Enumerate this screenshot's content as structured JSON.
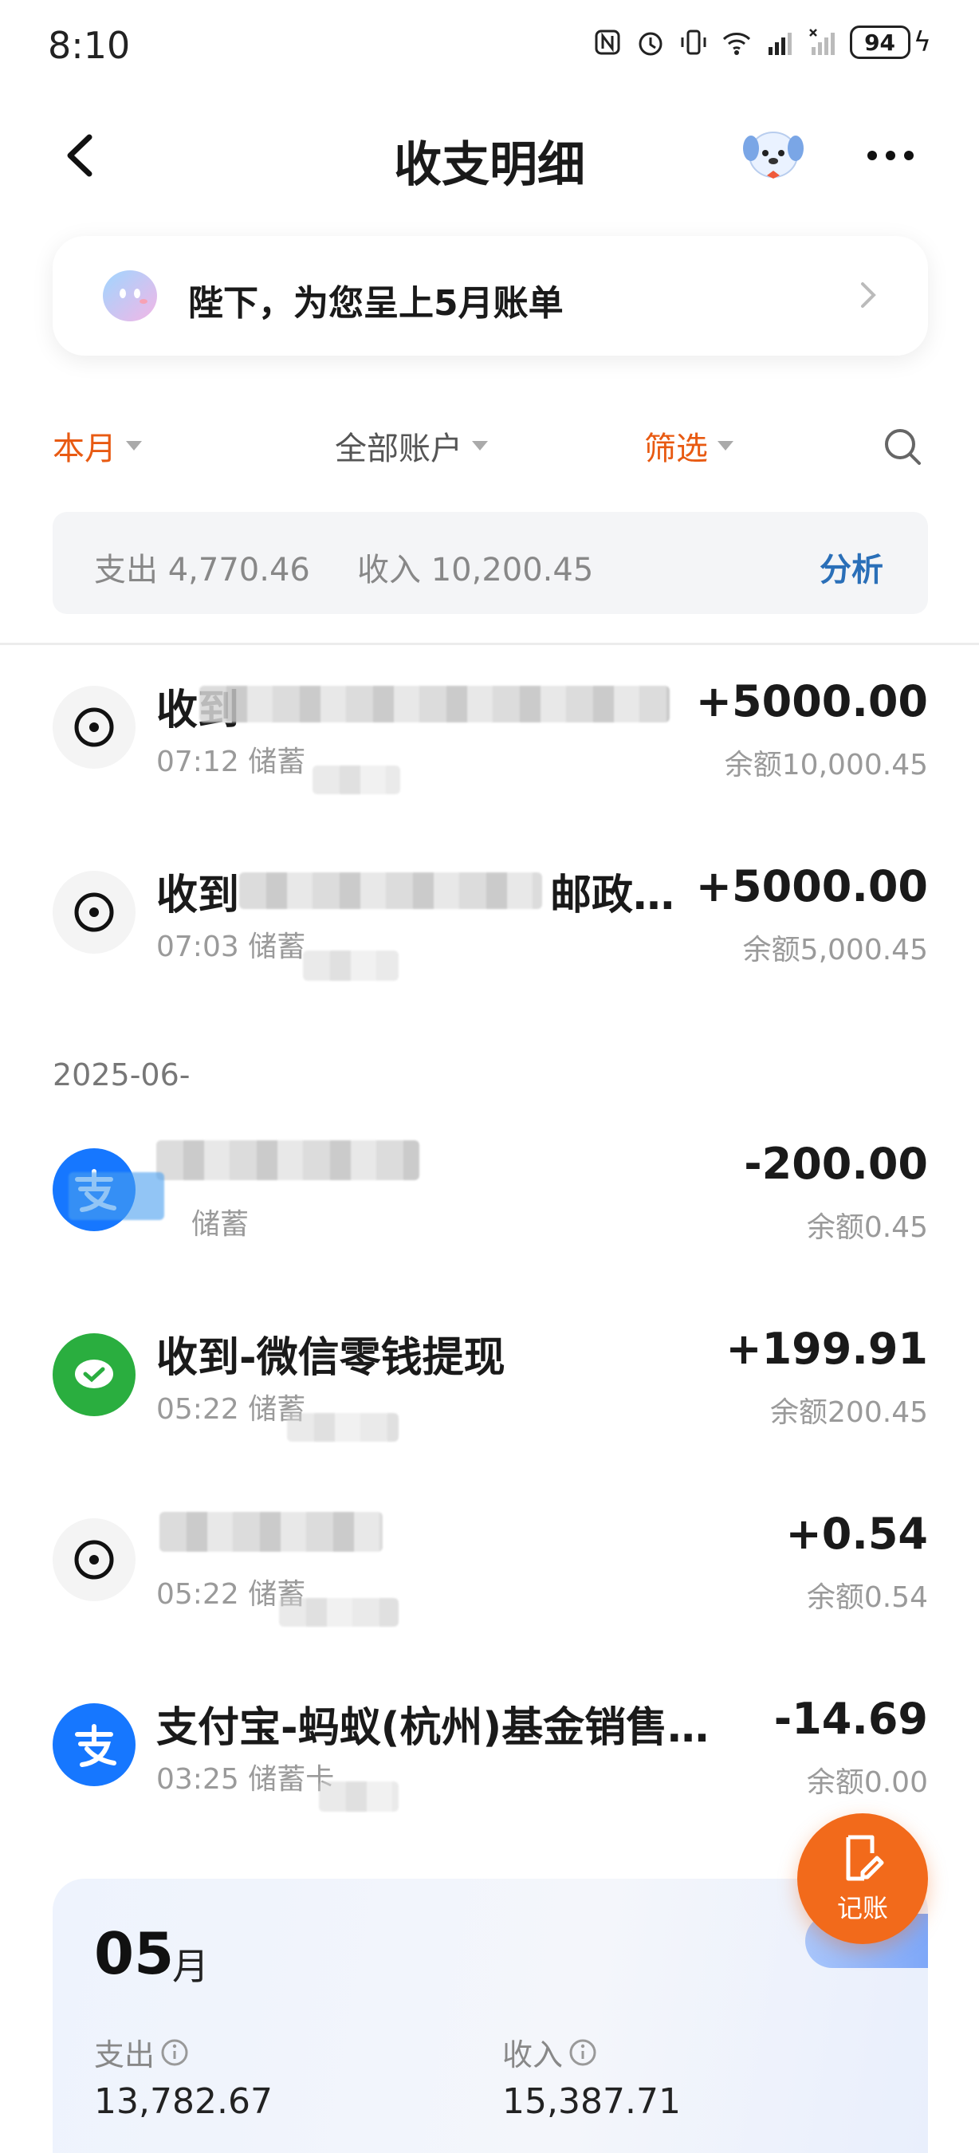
{
  "status_bar": {
    "time": "8:10",
    "battery": "94"
  },
  "nav": {
    "title": "收支明细"
  },
  "banner": {
    "text": "陛下，为您呈上5月账单"
  },
  "filters": {
    "month": "本月",
    "account": "全部账户",
    "screen": "筛选"
  },
  "summary": {
    "expense": "支出 4,770.46",
    "income": "收入 10,200.45",
    "analyze": "分析"
  },
  "date_header": "2025-06-",
  "transactions": [
    {
      "title": "收到",
      "sub": "07:12 储蓄",
      "amount": "+5000.00",
      "balance": "余额10,000.45",
      "icon": "transfer-icon"
    },
    {
      "title": "收到",
      "title_tail": "邮政储蓄...",
      "sub": "07:03 储蓄",
      "amount": "+5000.00",
      "balance": "余额5,000.45",
      "icon": "transfer-icon"
    },
    {
      "title": "",
      "sub": "储蓄",
      "amount": "-200.00",
      "balance": "余额0.45",
      "icon": "alipay-icon"
    },
    {
      "title": "收到-微信零钱提现",
      "sub": "05:22 储蓄",
      "amount": "+199.91",
      "balance": "余额200.45",
      "icon": "wechat-icon"
    },
    {
      "title": "",
      "sub": "05:22 储蓄",
      "amount": "+0.54",
      "balance": "余额0.54",
      "icon": "transfer-icon"
    },
    {
      "title": "支付宝-蚂蚁(杭州)基金销售有...",
      "sub": "03:25 储蓄卡",
      "amount": "-14.69",
      "balance": "余额0.00",
      "icon": "alipay-icon"
    }
  ],
  "fab": {
    "label": "记账"
  },
  "month_card": {
    "month": "05",
    "unit": "月",
    "expense_label": "支出",
    "expense_value": "13,782.67",
    "income_label": "收入",
    "income_value": "15,387.71"
  },
  "colors": {
    "accent": "#e85a12",
    "link": "#2a6fb8",
    "fab": "#f26a1b",
    "alipay": "#1677ff",
    "wechat": "#2aae3f"
  }
}
